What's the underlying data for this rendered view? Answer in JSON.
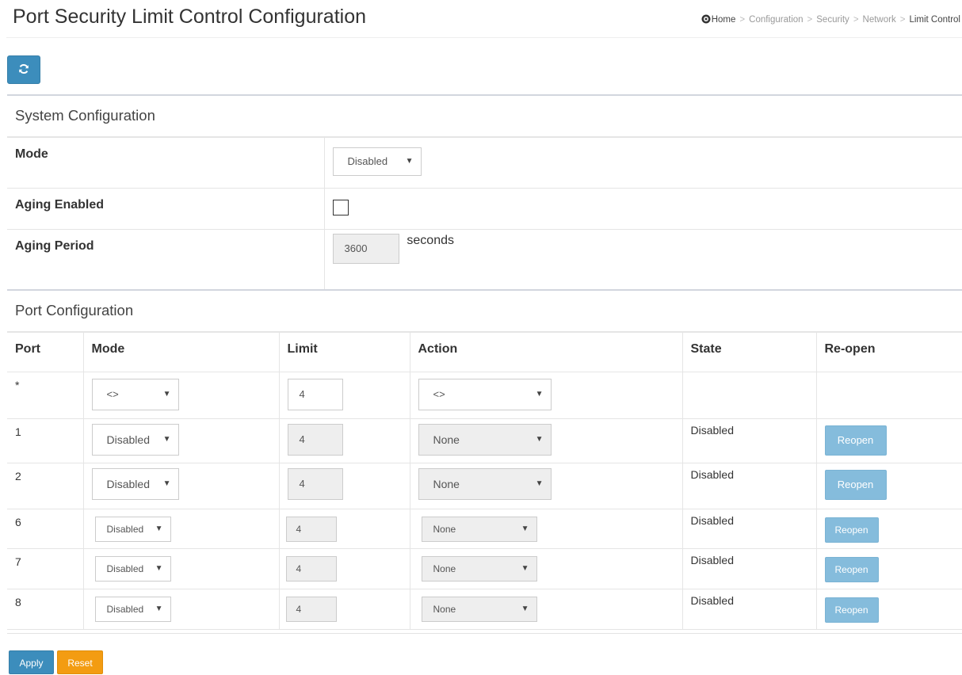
{
  "header": {
    "title": "Port Security Limit Control Configuration",
    "breadcrumb": [
      "Home",
      "Configuration",
      "Security",
      "Network",
      "Limit Control"
    ]
  },
  "system_config": {
    "title": "System Configuration",
    "mode_label": "Mode",
    "mode_value": "Disabled",
    "aging_enabled_label": "Aging Enabled",
    "aging_enabled_checked": false,
    "aging_period_label": "Aging Period",
    "aging_period_value": "3600",
    "aging_period_unit": "seconds"
  },
  "port_config": {
    "title": "Port Configuration",
    "columns": [
      "Port",
      "Mode",
      "Limit",
      "Action",
      "State",
      "Re-open"
    ],
    "wildcard_row": {
      "port": "*",
      "mode": "<>",
      "limit": "4",
      "action": "<>"
    },
    "rows": [
      {
        "port": "1",
        "mode": "Disabled",
        "limit": "4",
        "action": "None",
        "state": "Disabled",
        "reopen": "Reopen"
      },
      {
        "port": "2",
        "mode": "Disabled",
        "limit": "4",
        "action": "None",
        "state": "Disabled",
        "reopen": "Reopen"
      },
      {
        "port": "6",
        "mode": "Disabled",
        "limit": "4",
        "action": "None",
        "state": "Disabled",
        "reopen": "Reopen"
      },
      {
        "port": "7",
        "mode": "Disabled",
        "limit": "4",
        "action": "None",
        "state": "Disabled",
        "reopen": "Reopen"
      },
      {
        "port": "8",
        "mode": "Disabled",
        "limit": "4",
        "action": "None",
        "state": "Disabled",
        "reopen": "Reopen"
      }
    ]
  },
  "buttons": {
    "apply": "Apply",
    "reset": "Reset"
  },
  "colors": {
    "primary": "#3c8dbc",
    "reopen_disabled": "#85bcdc",
    "reset": "#f39c12"
  },
  "icons": {
    "refresh": "refresh-icon",
    "home": "home-icon",
    "dropdown": "chevron-down-icon"
  }
}
